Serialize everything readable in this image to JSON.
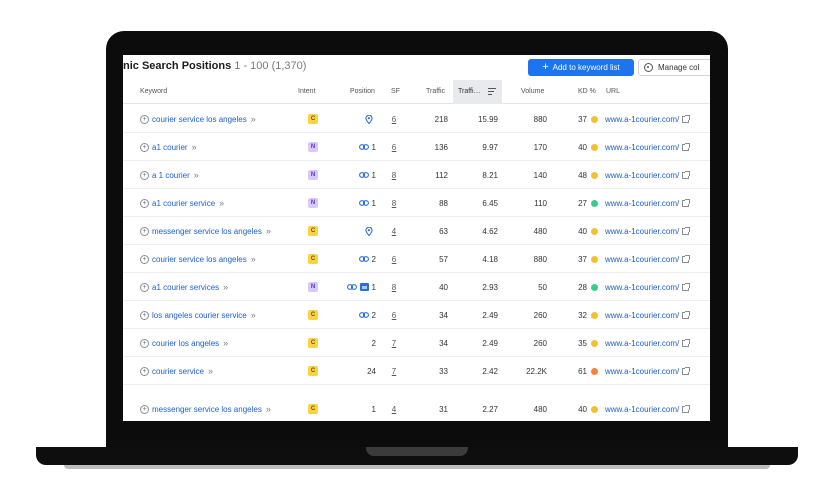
{
  "header": {
    "title": "nic Search Positions",
    "range": "1 - 100 (1,370)",
    "add_button": "Add to keyword list",
    "manage_button": "Manage col"
  },
  "columns": {
    "keyword": "Keyword",
    "intent": "Intent",
    "position": "Position",
    "sf": "SF",
    "traffic": "Traffic",
    "traffic_pct": "Traffi…",
    "volume": "Volume",
    "kd": "KD %",
    "url": "URL"
  },
  "colors": {
    "accent": "#1d74ef",
    "link": "#1d5fd1",
    "kd_yellow": "#f5c02f",
    "kd_green": "#3ccc8a",
    "kd_orange": "#f5823a",
    "intent_c": "#fbd146",
    "intent_n": "#d8c8fb"
  },
  "rows": [
    {
      "keyword": "courier service los angeles",
      "intent": "C",
      "position": "",
      "position_icons": [
        "pin-icon"
      ],
      "sf": "6",
      "traffic": "218",
      "traffic_pct": "15.99",
      "volume": "880",
      "kd": "37",
      "kd_color": "yellow",
      "url": "www.a-1courier.com/"
    },
    {
      "keyword": "a1 courier",
      "intent": "N",
      "position": "1",
      "position_icons": [
        "link-icon"
      ],
      "sf": "6",
      "traffic": "136",
      "traffic_pct": "9.97",
      "volume": "170",
      "kd": "40",
      "kd_color": "yellow",
      "url": "www.a-1courier.com/"
    },
    {
      "keyword": "a 1 courier",
      "intent": "N",
      "position": "1",
      "position_icons": [
        "link-icon"
      ],
      "sf": "8",
      "traffic": "112",
      "traffic_pct": "8.21",
      "volume": "140",
      "kd": "48",
      "kd_color": "yellow",
      "url": "www.a-1courier.com/"
    },
    {
      "keyword": "a1 courier service",
      "intent": "N",
      "position": "1",
      "position_icons": [
        "link-icon"
      ],
      "sf": "8",
      "traffic": "88",
      "traffic_pct": "6.45",
      "volume": "110",
      "kd": "27",
      "kd_color": "green",
      "url": "www.a-1courier.com/"
    },
    {
      "keyword": "messenger service los angeles",
      "intent": "C",
      "position": "",
      "position_icons": [
        "pin-icon"
      ],
      "sf": "4",
      "traffic": "63",
      "traffic_pct": "4.62",
      "volume": "480",
      "kd": "40",
      "kd_color": "yellow",
      "url": "www.a-1courier.com/"
    },
    {
      "keyword": "courier service los angeles",
      "intent": "C",
      "position": "2",
      "position_icons": [
        "link-icon"
      ],
      "sf": "6",
      "traffic": "57",
      "traffic_pct": "4.18",
      "volume": "880",
      "kd": "37",
      "kd_color": "yellow",
      "url": "www.a-1courier.com/"
    },
    {
      "keyword": "a1 courier services",
      "intent": "N",
      "position": "1",
      "position_icons": [
        "link-icon",
        "image-icon"
      ],
      "sf": "8",
      "traffic": "40",
      "traffic_pct": "2.93",
      "volume": "50",
      "kd": "28",
      "kd_color": "green",
      "url": "www.a-1courier.com/"
    },
    {
      "keyword": "los angeles courier service",
      "intent": "C",
      "position": "2",
      "position_icons": [
        "link-icon"
      ],
      "sf": "6",
      "traffic": "34",
      "traffic_pct": "2.49",
      "volume": "260",
      "kd": "32",
      "kd_color": "yellow",
      "url": "www.a-1courier.com/"
    },
    {
      "keyword": "courier los angeles",
      "intent": "C",
      "position": "2",
      "position_icons": [],
      "sf": "7",
      "traffic": "34",
      "traffic_pct": "2.49",
      "volume": "260",
      "kd": "35",
      "kd_color": "yellow",
      "url": "www.a-1courier.com/"
    },
    {
      "keyword": "courier service",
      "intent": "C",
      "position": "24",
      "position_icons": [],
      "sf": "7",
      "traffic": "33",
      "traffic_pct": "2.42",
      "volume": "22.2K",
      "kd": "61",
      "kd_color": "orange",
      "url": "www.a-1courier.com/"
    },
    {
      "keyword": "messenger service los angeles",
      "intent": "C",
      "position": "1",
      "position_icons": [],
      "sf": "4",
      "traffic": "31",
      "traffic_pct": "2.27",
      "volume": "480",
      "kd": "40",
      "kd_color": "yellow",
      "url": "www.a-1courier.com/"
    }
  ]
}
